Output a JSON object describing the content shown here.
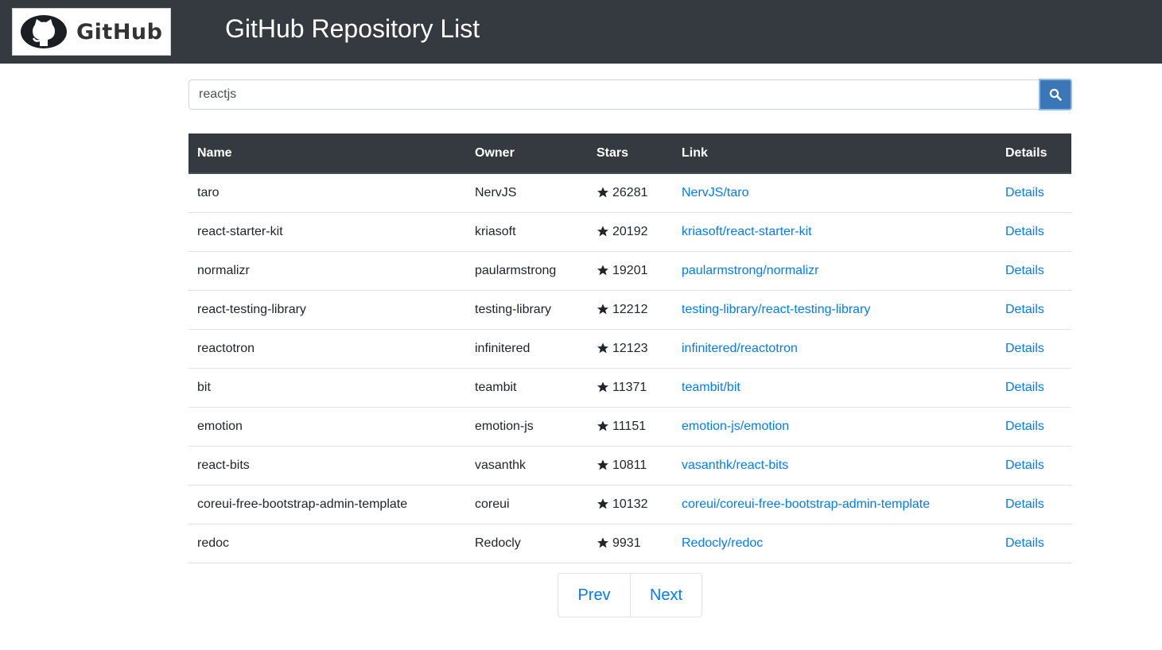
{
  "header": {
    "logo_text": "GitHub",
    "title": "GitHub Repository List",
    "background": "#343a40"
  },
  "search": {
    "value": "reactjs",
    "button_icon": "search-icon",
    "button_color": "#3b77b7"
  },
  "table": {
    "columns": [
      "Name",
      "Owner",
      "Stars",
      "Link",
      "Details"
    ],
    "star_icon": "star-icon",
    "rows": [
      {
        "name": "taro",
        "owner": "NervJS",
        "stars": "26281",
        "link": "NervJS/taro",
        "details": "Details"
      },
      {
        "name": "react-starter-kit",
        "owner": "kriasoft",
        "stars": "20192",
        "link": "kriasoft/react-starter-kit",
        "details": "Details"
      },
      {
        "name": "normalizr",
        "owner": "paularmstrong",
        "stars": "19201",
        "link": "paularmstrong/normalizr",
        "details": "Details"
      },
      {
        "name": "react-testing-library",
        "owner": "testing-library",
        "stars": "12212",
        "link": "testing-library/react-testing-library",
        "details": "Details"
      },
      {
        "name": "reactotron",
        "owner": "infinitered",
        "stars": "12123",
        "link": "infinitered/reactotron",
        "details": "Details"
      },
      {
        "name": "bit",
        "owner": "teambit",
        "stars": "11371",
        "link": "teambit/bit",
        "details": "Details"
      },
      {
        "name": "emotion",
        "owner": "emotion-js",
        "stars": "11151",
        "link": "emotion-js/emotion",
        "details": "Details"
      },
      {
        "name": "react-bits",
        "owner": "vasanthk",
        "stars": "10811",
        "link": "vasanthk/react-bits",
        "details": "Details"
      },
      {
        "name": "coreui-free-bootstrap-admin-template",
        "owner": "coreui",
        "stars": "10132",
        "link": "coreui/coreui-free-bootstrap-admin-template",
        "details": "Details"
      },
      {
        "name": "redoc",
        "owner": "Redocly",
        "stars": "9931",
        "link": "Redocly/redoc",
        "details": "Details"
      }
    ]
  },
  "pagination": {
    "prev_label": "Prev",
    "next_label": "Next"
  },
  "colors": {
    "link": "#007bff",
    "header_bg": "#343a40"
  }
}
